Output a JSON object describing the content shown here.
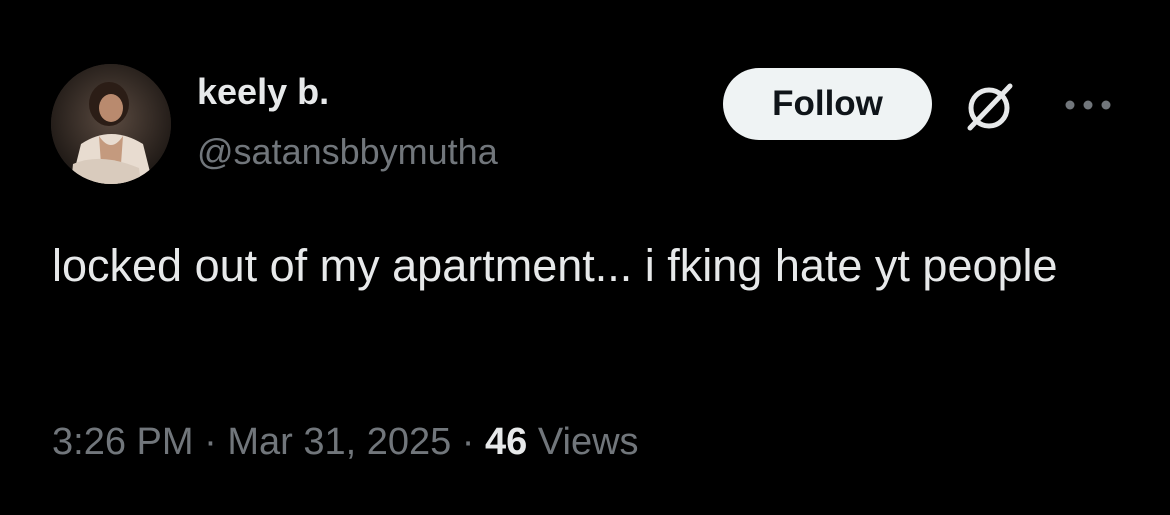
{
  "tweet": {
    "display_name": "keely b.",
    "handle": "@satansbbymutha",
    "follow_label": "Follow",
    "text": "locked out of my apartment... i fking hate yt people",
    "time": "3:26 PM",
    "date": "Mar 31, 2025",
    "separator": "·",
    "views_count": "46",
    "views_label": "Views"
  },
  "icons": {
    "grok": "grok-icon",
    "more": "more-icon"
  },
  "colors": {
    "background": "#000000",
    "primary_text": "#e7e9ea",
    "secondary_text": "#71767b",
    "follow_button_bg": "#eff3f4",
    "follow_button_text": "#0f1419"
  }
}
